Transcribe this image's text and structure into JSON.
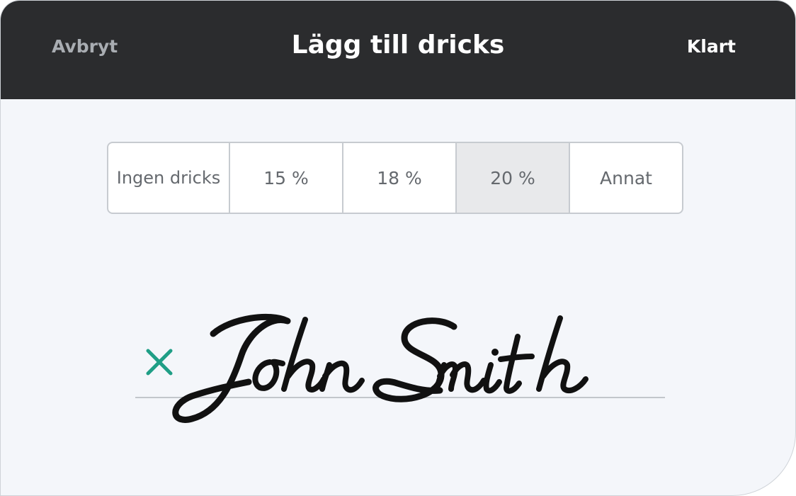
{
  "header": {
    "cancel_label": "Avbryt",
    "title": "Lägg till dricks",
    "done_label": "Klart"
  },
  "tip_options": [
    {
      "label": "Ingen dricks",
      "selected": false
    },
    {
      "label": "15 %",
      "selected": false
    },
    {
      "label": "18 %",
      "selected": false
    },
    {
      "label": "20 %",
      "selected": true
    },
    {
      "label": "Annat",
      "selected": false
    }
  ],
  "signature": {
    "name": "John Smith",
    "clear_icon": "close-icon",
    "clear_icon_color": "#1f9e86"
  },
  "colors": {
    "header_bg": "#2b2c2e",
    "body_bg": "#f4f6fa",
    "selected_segment_bg": "#e8e9eb"
  }
}
